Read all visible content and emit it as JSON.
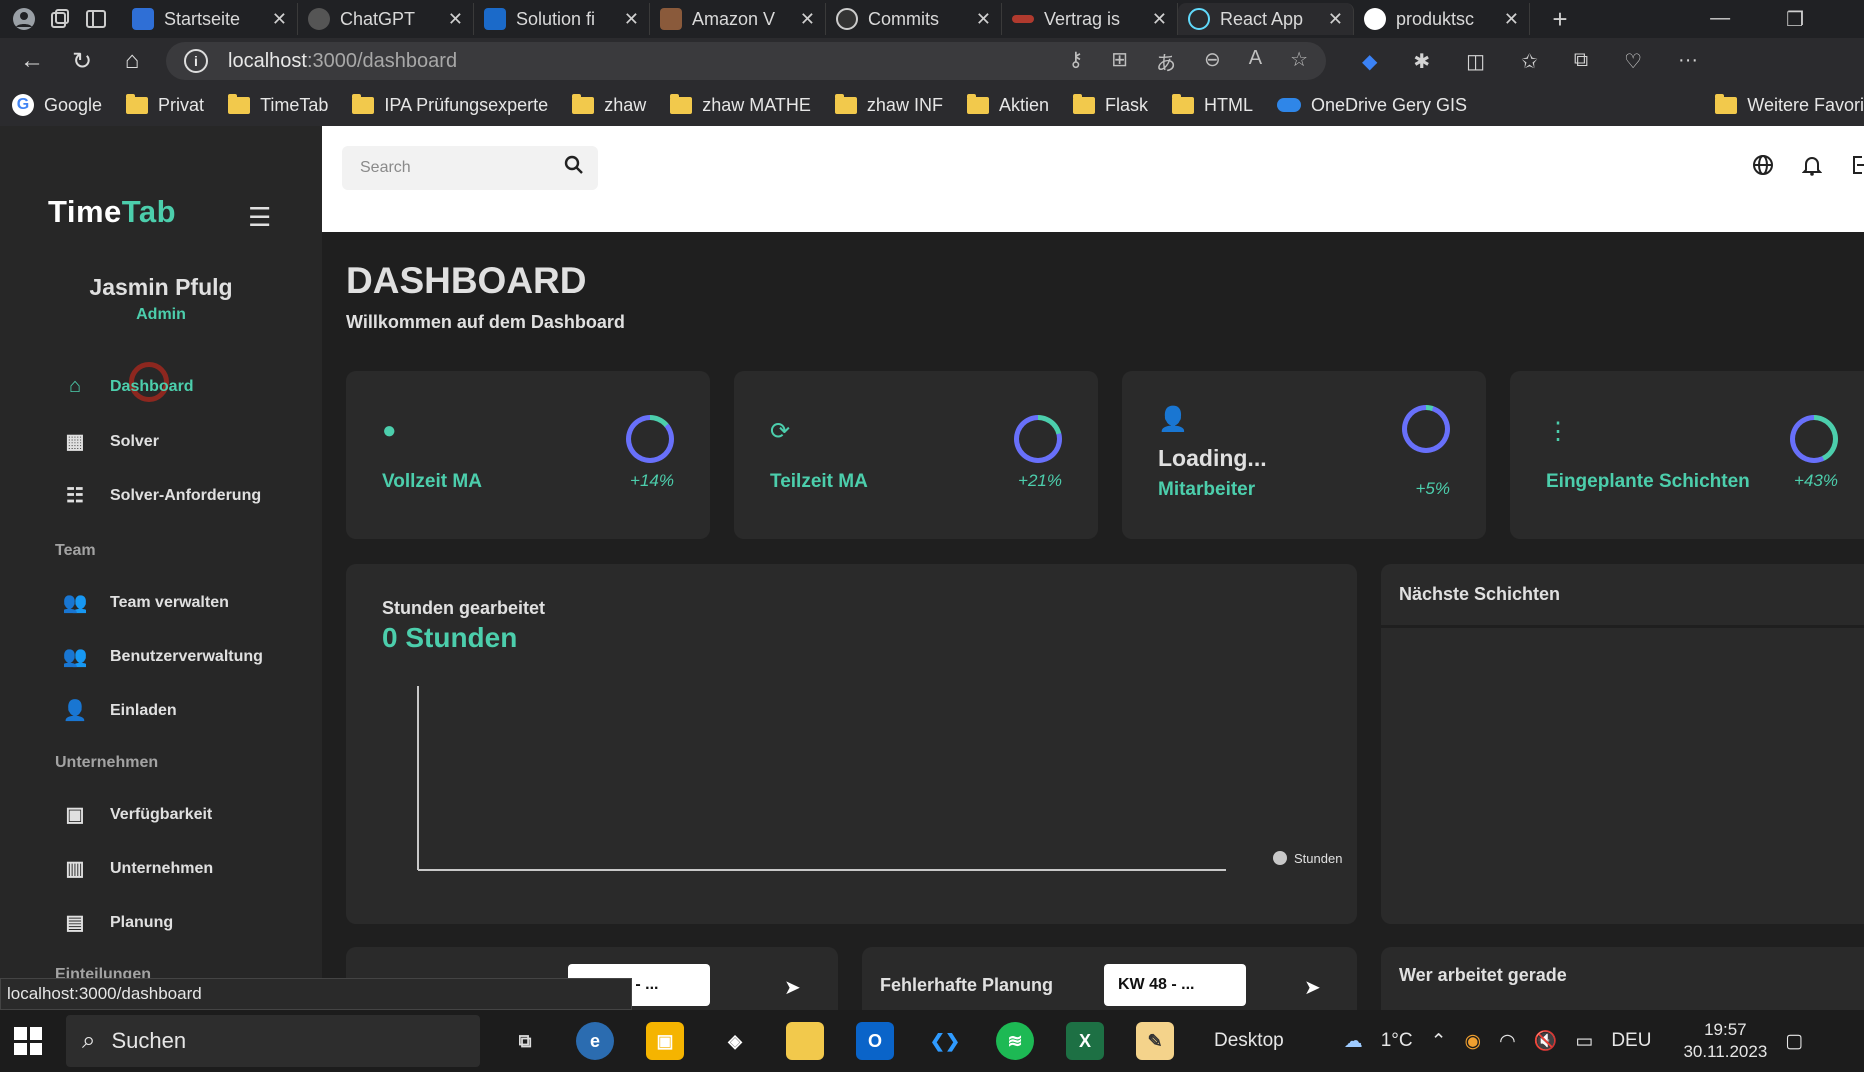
{
  "browser": {
    "tabs": [
      {
        "title": "Startseite",
        "color": "#2f6fd6"
      },
      {
        "title": "ChatGPT",
        "color": "#555555"
      },
      {
        "title": "Solution fi",
        "color": "#1b6ac9"
      },
      {
        "title": "Amazon V",
        "color": "#8a5a3b"
      },
      {
        "title": "Commits",
        "color": "#333333"
      },
      {
        "title": "Vertrag is",
        "color": "#b03a2e"
      },
      {
        "title": "React App",
        "color": "#61dafb"
      },
      {
        "title": "produktsc",
        "color": "#ffffff"
      }
    ],
    "url_host": "localhost",
    "url_path": ":3000/dashboard",
    "bookmarks": [
      "Google",
      "Privat",
      "TimeTab",
      "IPA Prüfungsexperte",
      "zhaw",
      "zhaw MATHE",
      "zhaw INF",
      "Aktien",
      "Flask",
      "HTML",
      "OneDrive Gery GIS"
    ],
    "bookmarks_more": "Weitere Favori",
    "status_url": "localhost:3000/dashboard"
  },
  "app": {
    "logo_time": "Time",
    "logo_tab": "Tab",
    "user": {
      "name": "Jasmin Pfulg",
      "role": "Admin"
    },
    "nav": {
      "dashboard": "Dashboard",
      "solver": "Solver",
      "solver_req": "Solver-Anforderung",
      "section_team": "Team",
      "team_manage": "Team verwalten",
      "user_manage": "Benutzerverwaltung",
      "invite": "Einladen",
      "section_company": "Unternehmen",
      "availability": "Verfügbarkeit",
      "company": "Unternehmen",
      "planning": "Planung",
      "section_assign": "Einteilungen"
    },
    "search_placeholder": "Search",
    "page_title": "DASHBOARD",
    "page_subtitle": "Willkommen auf dem Dashboard",
    "stats": [
      {
        "label": "Vollzeit MA",
        "value": "",
        "pct": "+14%",
        "progress": 0.14
      },
      {
        "label": "Teilzeit MA",
        "value": "",
        "pct": "+21%",
        "progress": 0.21
      },
      {
        "label": "Mitarbeiter",
        "value": "Loading...",
        "pct": "+5%",
        "progress": 0.05
      },
      {
        "label": "Eingeplante Schichten",
        "value": "",
        "pct": "+43%",
        "progress": 0.43
      }
    ],
    "hours_card": {
      "title": "Stunden gearbeitet",
      "value": "0 Stunden",
      "legend": "Stunden"
    },
    "next_shifts_title": "Nächste Schichten",
    "bottom": {
      "card1_select": "KW 48 - ...",
      "card2_title": "Fehlerhafte Planung",
      "card2_select": "KW 48 - ...",
      "card3_title": "Wer arbeitet gerade"
    },
    "accent": "#4cceac"
  },
  "chart_data": {
    "type": "line",
    "x": [],
    "series": [
      {
        "name": "Stunden",
        "values": []
      }
    ],
    "title": "Stunden gearbeitet",
    "legend": "right"
  },
  "taskbar": {
    "search": "Suchen",
    "desktop": "Desktop",
    "temp": "1°C",
    "lang": "DEU",
    "time": "19:57",
    "date": "30.11.2023"
  }
}
